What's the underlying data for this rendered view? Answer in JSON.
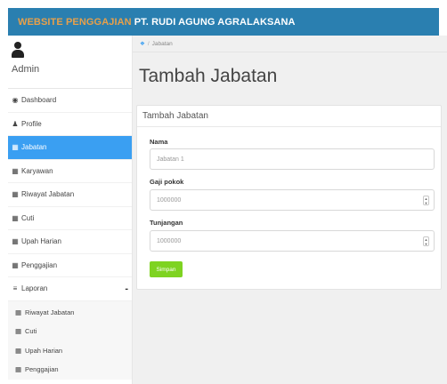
{
  "header": {
    "title_prefix": "WEBSITE PENGGAJIAN",
    "title_company": "PT. RUDI AGUNG AGRALAKSANA"
  },
  "user": {
    "name": "Admin",
    "icon": "user-icon"
  },
  "sidebar": {
    "items": [
      {
        "label": "Dashboard",
        "icon": "dashboard-icon"
      },
      {
        "label": "Profile",
        "icon": "user-icon"
      },
      {
        "label": "Jabatan",
        "icon": "table-icon"
      },
      {
        "label": "Karyawan",
        "icon": "table-icon"
      },
      {
        "label": "Riwayat Jabatan",
        "icon": "table-icon"
      },
      {
        "label": "Cuti",
        "icon": "table-icon"
      },
      {
        "label": "Upah Harian",
        "icon": "table-icon"
      },
      {
        "label": "Penggajian",
        "icon": "table-icon"
      }
    ],
    "active_index": 2,
    "laporan": {
      "label": "Laporan",
      "toggle": "-",
      "subitems": [
        {
          "label": "Riwayat Jabatan"
        },
        {
          "label": "Cuti"
        },
        {
          "label": "Upah Harian"
        },
        {
          "label": "Penggajian"
        }
      ]
    }
  },
  "breadcrumb": {
    "current": "Jabatan"
  },
  "page": {
    "title": "Tambah Jabatan"
  },
  "form": {
    "panel_title": "Tambah Jabatan",
    "fields": [
      {
        "label": "Nama",
        "placeholder": "Jabatan 1"
      },
      {
        "label": "Gaji pokok",
        "placeholder": "1000000"
      },
      {
        "label": "Tunjangan",
        "placeholder": "1000000"
      }
    ],
    "submit_label": "Simpan"
  },
  "colors": {
    "topbar": "#2a7fb0",
    "title_prefix": "#e8a04a",
    "active_item": "#3a9ff2",
    "submit_button": "#7ed321"
  }
}
